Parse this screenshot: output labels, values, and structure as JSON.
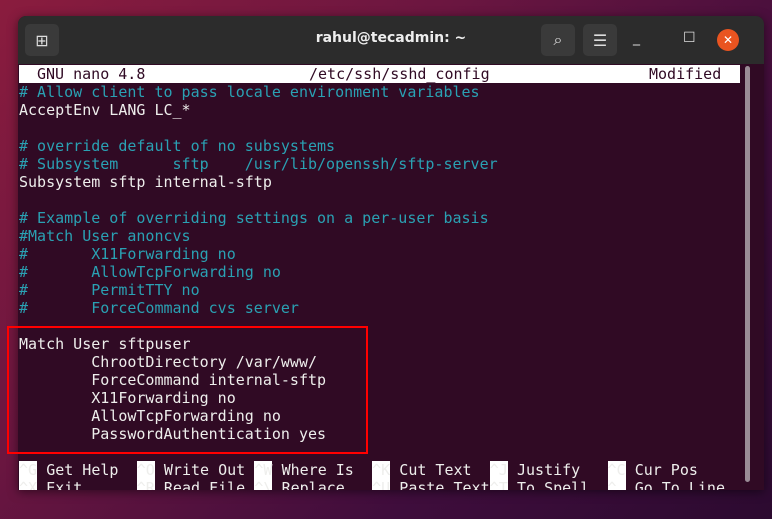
{
  "window": {
    "title": "rahul@tecadmin: ~",
    "new_tab_icon": "new-tab-icon",
    "search_icon": "search-icon",
    "menu_icon": "hamburger-icon"
  },
  "nano": {
    "version": "GNU nano 4.8",
    "filename": "/etc/ssh/sshd_config",
    "status": "Modified"
  },
  "lines": [
    {
      "text": "# Allow client to pass locale environment variables",
      "comment": true
    },
    {
      "text": "AcceptEnv LANG LC_*",
      "comment": false
    },
    {
      "text": "",
      "comment": false
    },
    {
      "text": "# override default of no subsystems",
      "comment": true
    },
    {
      "text": "# Subsystem      sftp    /usr/lib/openssh/sftp-server",
      "comment": true
    },
    {
      "text": "Subsystem sftp internal-sftp",
      "comment": false
    },
    {
      "text": "",
      "comment": false
    },
    {
      "text": "# Example of overriding settings on a per-user basis",
      "comment": true
    },
    {
      "text": "#Match User anoncvs",
      "comment": true
    },
    {
      "text": "#       X11Forwarding no",
      "comment": true
    },
    {
      "text": "#       AllowTcpForwarding no",
      "comment": true
    },
    {
      "text": "#       PermitTTY no",
      "comment": true
    },
    {
      "text": "#       ForceCommand cvs server",
      "comment": true
    },
    {
      "text": "",
      "comment": false
    },
    {
      "text": "Match User sftpuser",
      "comment": false
    },
    {
      "text": "        ChrootDirectory /var/www/",
      "comment": false
    },
    {
      "text": "        ForceCommand internal-sftp",
      "comment": false
    },
    {
      "text": "        X11Forwarding no",
      "comment": false
    },
    {
      "text": "        AllowTcpForwarding no",
      "comment": false
    },
    {
      "text": "        PasswordAuthentication yes",
      "comment": false
    }
  ],
  "shortcuts": [
    [
      {
        "key": "^G",
        "label": "Get Help"
      },
      {
        "key": "^O",
        "label": "Write Out"
      },
      {
        "key": "^W",
        "label": "Where Is"
      },
      {
        "key": "^K",
        "label": "Cut Text"
      },
      {
        "key": "^J",
        "label": "Justify"
      },
      {
        "key": "^C",
        "label": "Cur Pos"
      }
    ],
    [
      {
        "key": "^X",
        "label": "Exit"
      },
      {
        "key": "^R",
        "label": "Read File"
      },
      {
        "key": "^\\",
        "label": "Replace"
      },
      {
        "key": "^U",
        "label": "Paste Text"
      },
      {
        "key": "^T",
        "label": "To Spell"
      },
      {
        "key": "^_",
        "label": "Go To Line"
      }
    ]
  ],
  "colors": {
    "terminal_bg": "#300a24",
    "comment": "#2aa1b3",
    "highlight_box": "#ff0000",
    "close_button": "#e95420"
  }
}
